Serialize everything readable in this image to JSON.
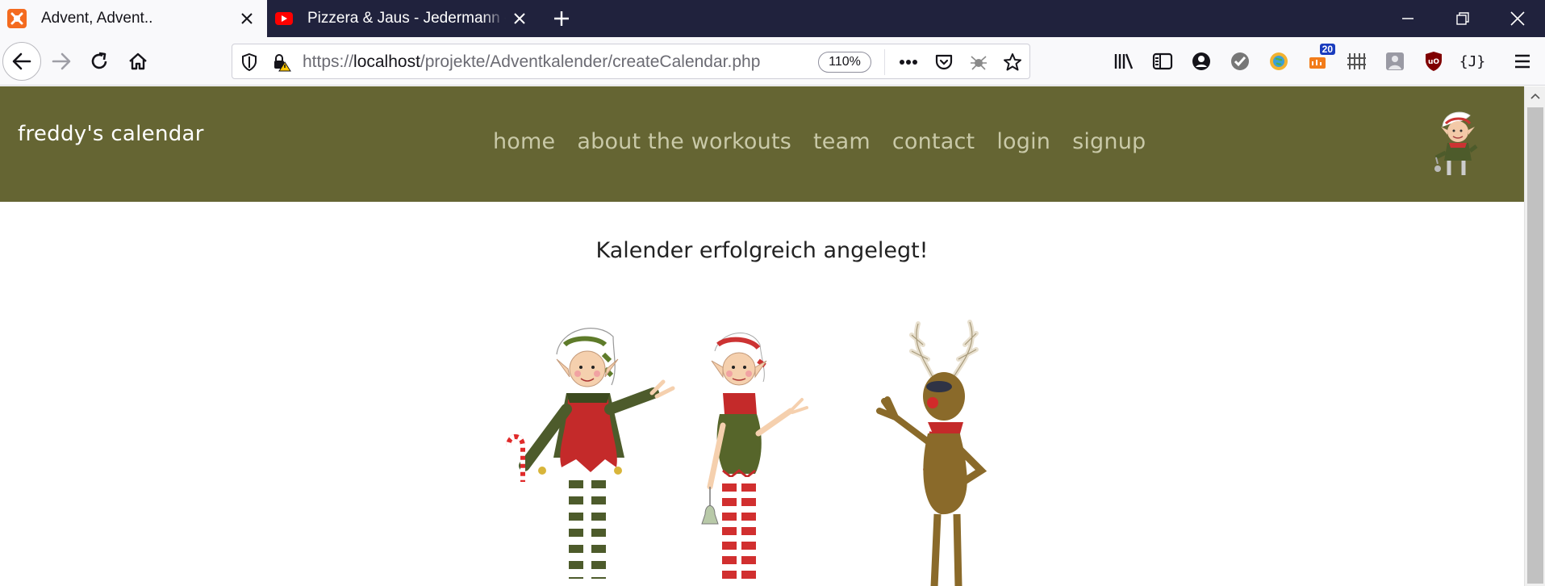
{
  "browser": {
    "tabs": [
      {
        "title": "Advent, Advent..",
        "active": true,
        "favicon": "xampp-icon"
      },
      {
        "title": "Pizzera & Jaus - Jedermann - Yo",
        "active": false,
        "favicon": "youtube-icon"
      }
    ],
    "url": {
      "scheme": "https://",
      "host": "localhost",
      "path": "/projekte/Adventkalender/createCalendar.php"
    },
    "zoom": "110%",
    "extension_badge": "20"
  },
  "site": {
    "brand": "freddy's calendar",
    "menu": [
      "home",
      "about the workouts",
      "team",
      "contact",
      "login",
      "signup"
    ],
    "colors": {
      "header_bg": "#656533",
      "menu_text": "#c9c9a8"
    }
  },
  "main": {
    "message": "Kalender erfolgreich angelegt!",
    "illustration": "two-elves-and-reindeer-waving"
  }
}
